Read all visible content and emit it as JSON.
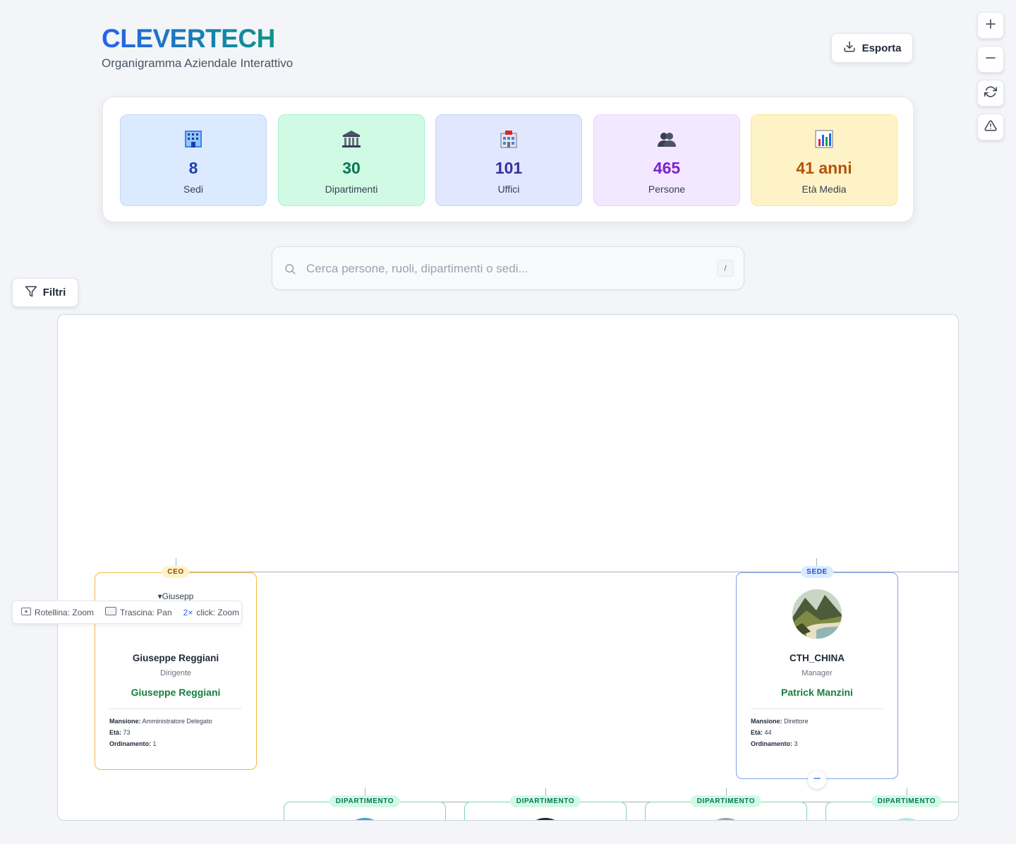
{
  "header": {
    "brand": "CLEVERTECH",
    "subtitle": "Organigramma Aziendale Interattivo",
    "export_label": "Esporta"
  },
  "tools": [
    {
      "name": "zoom-in-icon"
    },
    {
      "name": "zoom-out-icon"
    },
    {
      "name": "reset-icon"
    },
    {
      "name": "warning-icon"
    }
  ],
  "stats": [
    {
      "icon": "building-icon",
      "value": "8",
      "label": "Sedi",
      "color": "#1e40af",
      "bg": "#dbeafe",
      "border": "#bfdbfe"
    },
    {
      "icon": "classical-building-icon",
      "value": "30",
      "label": "Dipartimenti",
      "color": "#047857",
      "bg": "#d1fae5",
      "border": "#a7f3d0"
    },
    {
      "icon": "office-icon",
      "value": "101",
      "label": "Uffici",
      "color": "#3730a3",
      "bg": "#e0e7ff",
      "border": "#c7d2fe"
    },
    {
      "icon": "people-icon",
      "value": "465",
      "label": "Persone",
      "color": "#7e22ce",
      "bg": "#f3e8ff",
      "border": "#e9d5ff"
    },
    {
      "icon": "chart-icon",
      "value": "41 anni",
      "label": "Età Media",
      "color": "#b45309",
      "bg": "#fef3c7",
      "border": "#fde68a"
    }
  ],
  "search": {
    "placeholder": "Cerca persone, ruoli, dipartimenti o sedi...",
    "shortcut": "/"
  },
  "filter_label": "Filtri",
  "hints": [
    {
      "key": "",
      "text": "Rotellina: Zoom"
    },
    {
      "key": "",
      "text": "Trascina: Pan"
    },
    {
      "key": "2×",
      "text": "click: Zoom"
    }
  ],
  "org": {
    "ceo_card": {
      "badge": "CEO",
      "avatar_alt": "Giusepp",
      "name": "Giuseppe Reggiani",
      "role": "Dirigente",
      "manager": "Giuseppe Reggiani",
      "mansione_label": "Mansione:",
      "mansione": "Amministratore Delegato",
      "eta_label": "Età:",
      "eta": "73",
      "ord_label": "Ordinamento:",
      "ord": "1",
      "accent": "#f5b942"
    },
    "sede_card": {
      "badge": "SEDE",
      "name": "CTH_CHINA",
      "role": "Manager",
      "manager": "Patrick Manzini",
      "mansione_label": "Mansione:",
      "mansione": "Direttore",
      "eta_label": "Età:",
      "eta": "44",
      "ord_label": "Ordinamento:",
      "ord": "3",
      "accent": "#7fa3e8"
    },
    "departments": [
      {
        "badge": "DIPARTIMENTO"
      },
      {
        "badge": "DIPARTIMENTO"
      },
      {
        "badge": "DIPARTIMENTO"
      },
      {
        "badge": "DIPARTIMENTO"
      }
    ]
  }
}
